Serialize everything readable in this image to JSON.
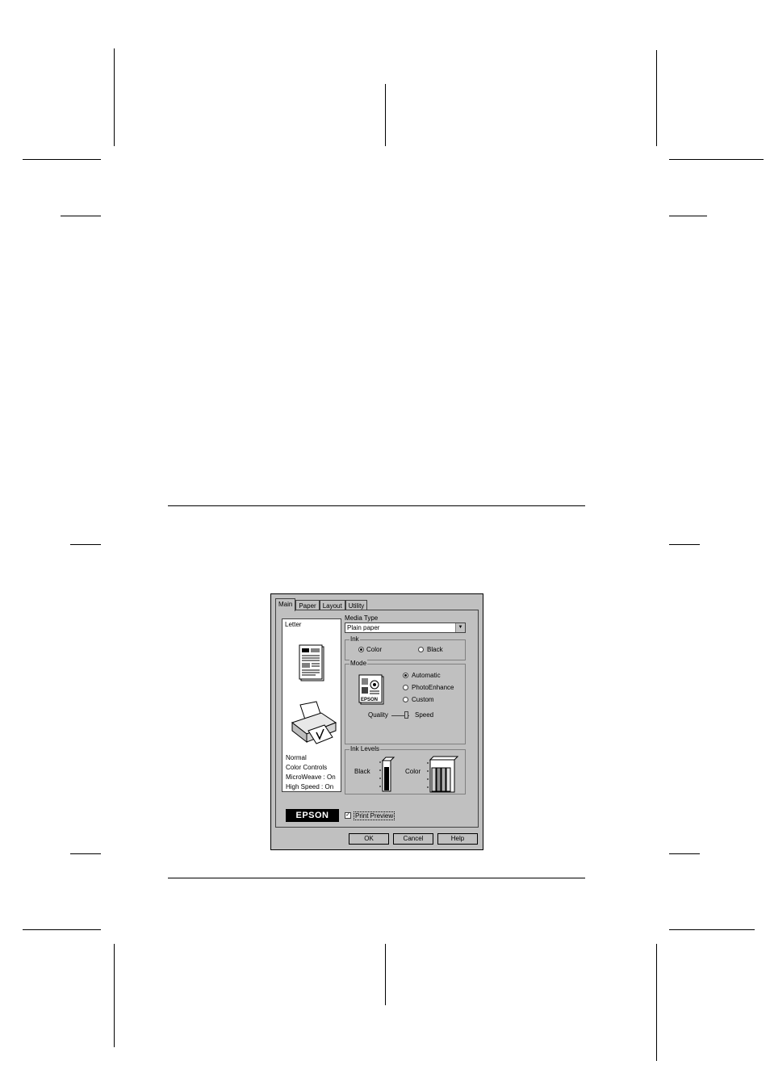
{
  "dialog": {
    "tabs": [
      "Main",
      "Paper",
      "Layout",
      "Utility"
    ],
    "active_tab": "Main",
    "preview": {
      "paper_size": "Letter",
      "settings": [
        "Normal",
        "Color Controls",
        "MicroWeave : On",
        "High Speed : On"
      ]
    },
    "media_type": {
      "label": "Media Type",
      "value": "Plain paper"
    },
    "ink": {
      "title": "Ink",
      "options": [
        "Color",
        "Black"
      ],
      "selected": "Color"
    },
    "mode": {
      "title": "Mode",
      "options": [
        "Automatic",
        "PhotoEnhance",
        "Custom"
      ],
      "selected": "Automatic",
      "icon_text": "EPSON",
      "slider_left": "Quality",
      "slider_right": "Speed"
    },
    "ink_levels": {
      "title": "Ink Levels",
      "black_label": "Black",
      "color_label": "Color"
    },
    "logo": "EPSON",
    "print_preview": {
      "label": "Print Preview",
      "checked": true
    },
    "buttons": {
      "ok": "OK",
      "cancel": "Cancel",
      "help": "Help"
    }
  }
}
